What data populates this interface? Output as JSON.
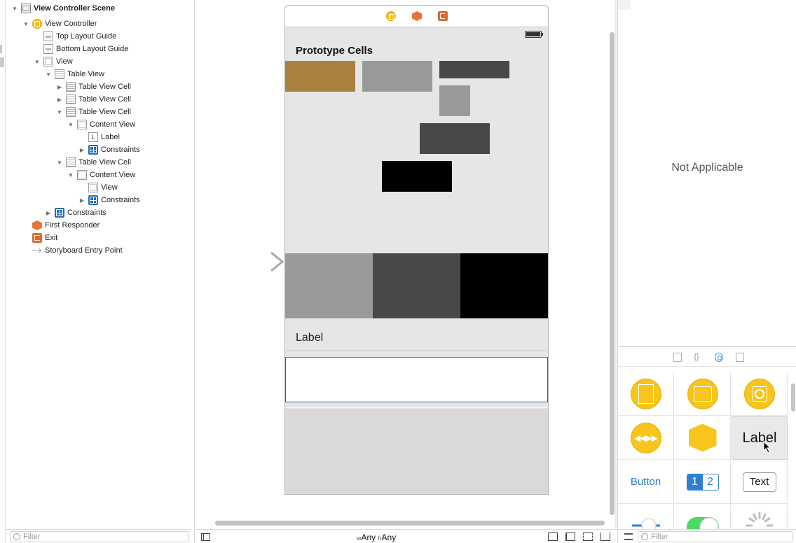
{
  "outline": {
    "items": [
      {
        "label": "View Controller Scene",
        "icon": "scene-icon",
        "bold": true
      },
      {
        "label": "View Controller",
        "icon": "view-controller-icon"
      },
      {
        "label": "Top Layout Guide",
        "icon": "layout-guide-icon"
      },
      {
        "label": "Bottom Layout Guide",
        "icon": "layout-guide-icon"
      },
      {
        "label": "View",
        "icon": "view-icon"
      },
      {
        "label": "Table View",
        "icon": "table-view-icon"
      },
      {
        "label": "Table View Cell",
        "icon": "table-view-cell-icon"
      },
      {
        "label": "Table View Cell",
        "icon": "table-view-cell-icon"
      },
      {
        "label": "Table View Cell",
        "icon": "table-view-cell-icon"
      },
      {
        "label": "Content View",
        "icon": "view-icon"
      },
      {
        "label": "Label",
        "icon": "label-icon"
      },
      {
        "label": "Constraints",
        "icon": "constraints-icon"
      },
      {
        "label": "Table View Cell",
        "icon": "table-view-cell-icon"
      },
      {
        "label": "Content View",
        "icon": "view-icon"
      },
      {
        "label": "View",
        "icon": "view-icon"
      },
      {
        "label": "Constraints",
        "icon": "constraints-icon"
      },
      {
        "label": "Constraints",
        "icon": "constraints-icon"
      },
      {
        "label": "First Responder",
        "icon": "first-responder-icon"
      },
      {
        "label": "Exit",
        "icon": "exit-icon"
      },
      {
        "label": "Storyboard Entry Point",
        "icon": "entry-arrow-icon"
      }
    ],
    "label_icon_glyph": "L",
    "filter_placeholder": "Filter"
  },
  "scene": {
    "prototype_title": "Prototype Cells",
    "cell_label": "Label",
    "colors": {
      "gold": "#a8813e",
      "light_gray": "#9a9a9a",
      "dark_gray": "#484848",
      "black": "#000000",
      "selection_border": "#2a5fa0"
    }
  },
  "canvas_bar": {
    "w_prefix": "w",
    "w_value": "Any",
    "h_prefix": "h",
    "h_value": "Any"
  },
  "inspector": {
    "not_applicable": "Not Applicable"
  },
  "library": {
    "tabs": [
      "file-template-icon",
      "code-snippet-icon",
      "object-library-icon",
      "media-library-icon"
    ],
    "code_tab_glyph": "{}",
    "items": {
      "label": "Label",
      "button": "Button",
      "segment_1": "1",
      "segment_2": "2",
      "text_field": "Text"
    },
    "filter_placeholder": "Filter"
  }
}
